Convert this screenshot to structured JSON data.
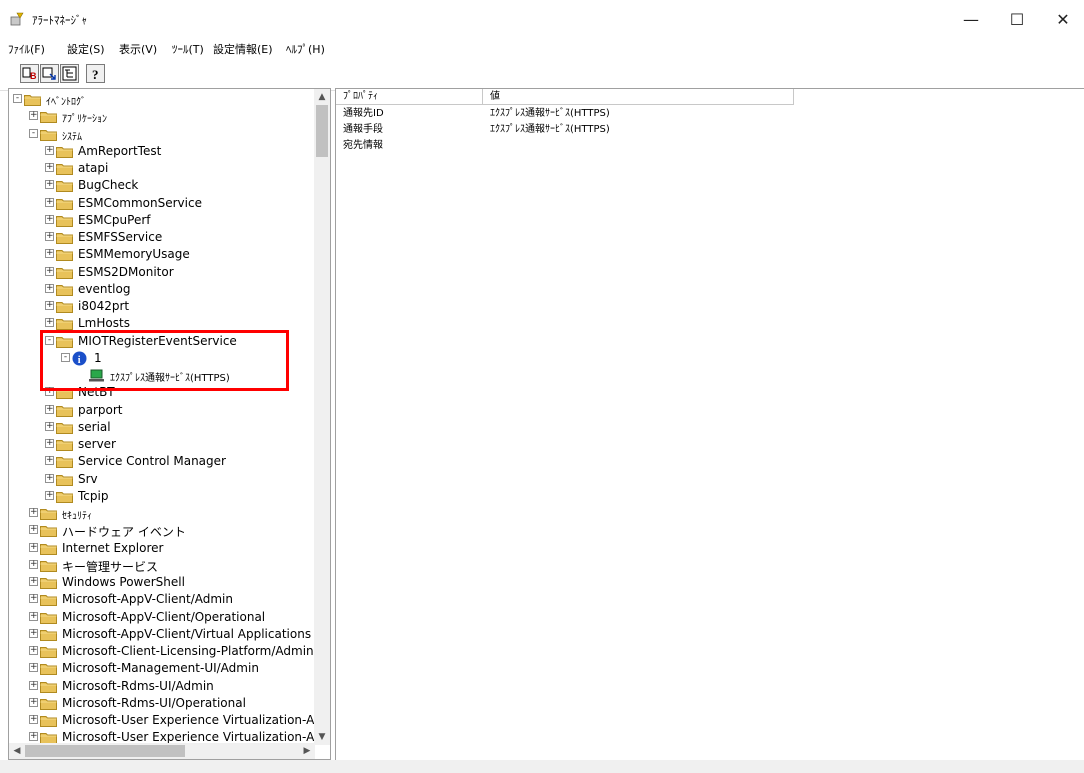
{
  "window": {
    "title": "ｱﾗｰﾄﾏﾈｰｼﾞｬ",
    "minimize": "—",
    "maximize": "☐",
    "close": "✕"
  },
  "menu": [
    {
      "label": "ﾌｧｲﾙ(F)"
    },
    {
      "label": "設定(S)"
    },
    {
      "label": "表示(V)"
    },
    {
      "label": "ﾂｰﾙ(T)"
    },
    {
      "label": "設定情報(E)"
    },
    {
      "label": "ﾍﾙﾌﾟ(H)"
    }
  ],
  "toolbar": {
    "buttons": [
      {
        "icon": "settings-b-icon"
      },
      {
        "icon": "refresh-icon"
      },
      {
        "icon": "tree-view-icon"
      },
      {
        "icon": "help-icon"
      }
    ]
  },
  "tree": {
    "root": "ｲﾍﾞﾝﾄﾛｸﾞ",
    "application": "ｱﾌﾟﾘｹｰｼｮﾝ",
    "system": "ｼｽﾃﾑ",
    "system_children_before": [
      "AmReportTest",
      "atapi",
      "BugCheck",
      "ESMCommonService",
      "ESMCpuPerf",
      "ESMFSService",
      "ESMMemoryUsage",
      "ESMS2DMonitor",
      "eventlog",
      "i8042prt",
      "LmHosts"
    ],
    "miot": {
      "label": "MIOTRegisterEventService",
      "event_id": "1",
      "notify": "ｴｸｽﾌﾟﾚｽ通報ｻｰﾋﾞｽ(HTTPS)"
    },
    "netbt_partial": "NetBT",
    "system_children_after": [
      "parport",
      "serial",
      "server",
      "Service Control Manager",
      "Srv",
      "Tcpip"
    ],
    "other_logs": [
      "ｾｷｭﾘﾃｨ",
      "ハードウェア イベント",
      "Internet Explorer",
      "キー管理サービス",
      "Windows PowerShell",
      "Microsoft-AppV-Client/Admin",
      "Microsoft-AppV-Client/Operational",
      "Microsoft-AppV-Client/Virtual Applications",
      "Microsoft-Client-Licensing-Platform/Admin",
      "Microsoft-Management-UI/Admin",
      "Microsoft-Rdms-UI/Admin",
      "Microsoft-Rdms-UI/Operational",
      "Microsoft-User Experience Virtualization-Agent Driver/Operational",
      "Microsoft-User Experience Virtualization-App Agent/Operational"
    ]
  },
  "list": {
    "columns": [
      "ﾌﾟﾛﾊﾟﾃｨ",
      "値"
    ],
    "rows": [
      [
        "通報先ID",
        "ｴｸｽﾌﾟﾚｽ通報ｻｰﾋﾞｽ(HTTPS)"
      ],
      [
        "通報手段",
        "ｴｸｽﾌﾟﾚｽ通報ｻｰﾋﾞｽ(HTTPS)"
      ],
      [
        "宛先情報",
        ""
      ]
    ]
  },
  "colors": {
    "highlight": "#ff0000",
    "folder": "#e8c25a",
    "info": "#1a4fc9"
  }
}
